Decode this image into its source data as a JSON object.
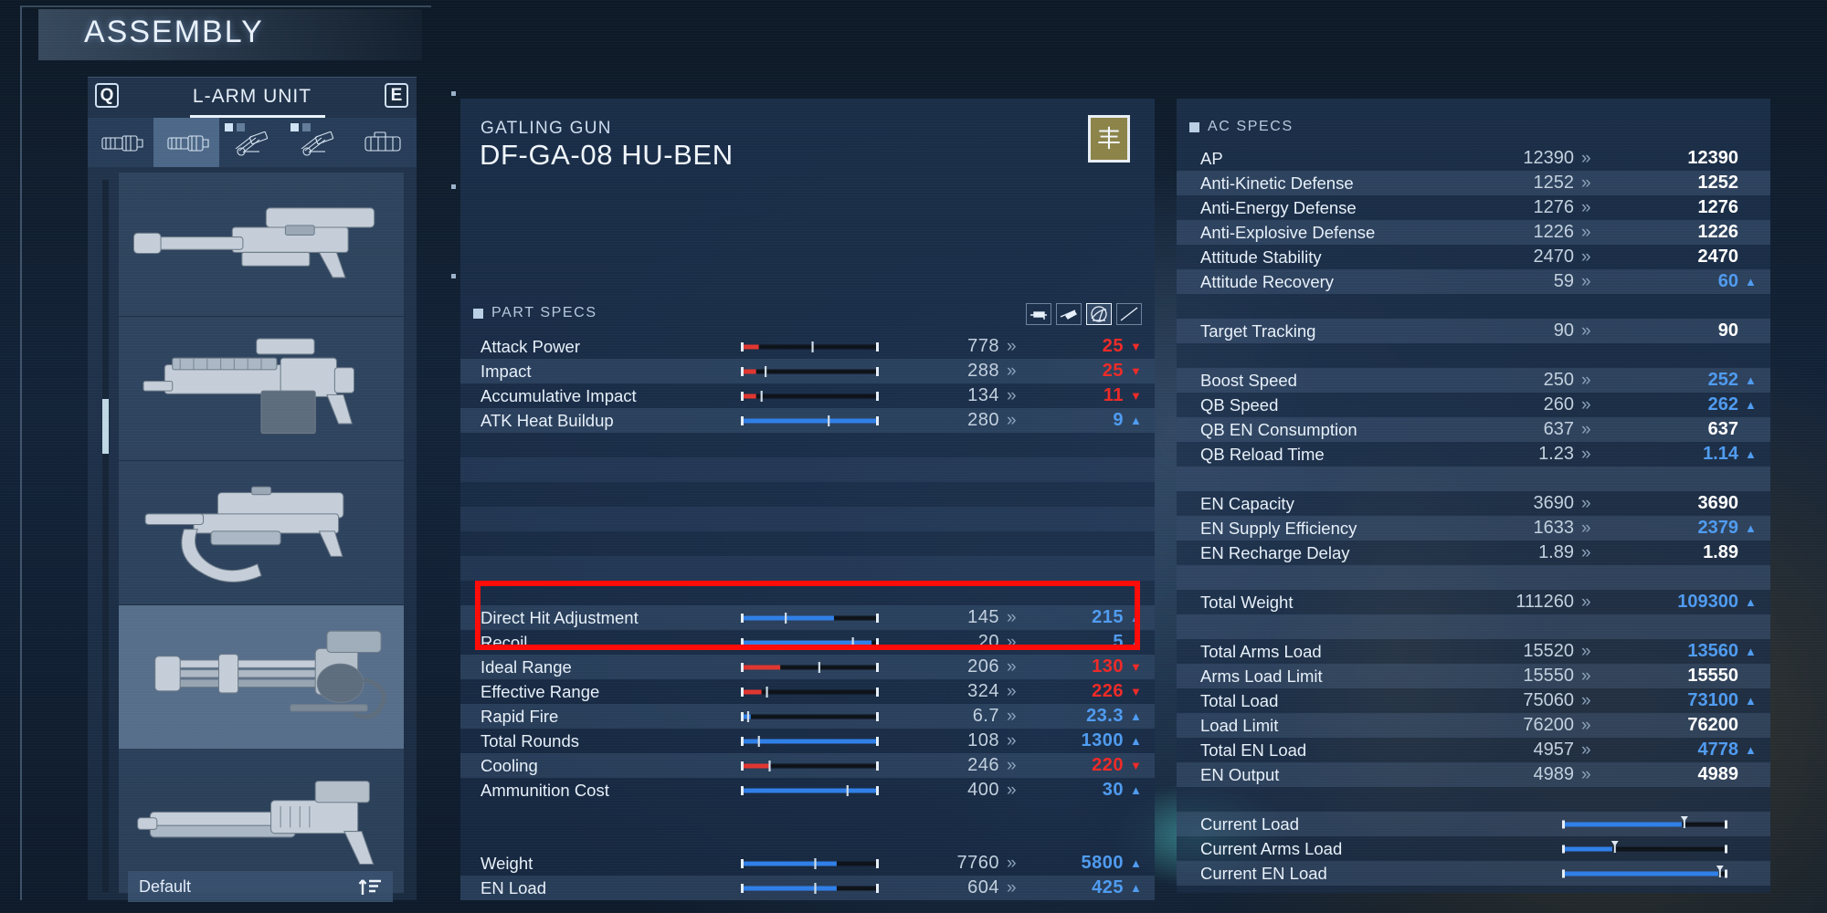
{
  "header": {
    "title": "ASSEMBLY"
  },
  "sidebar": {
    "prev_key": "Q",
    "next_key": "E",
    "category": "L-ARM UNIT",
    "tabs": [
      {
        "name": "tab-arm-unit-1",
        "icon": "arm-unit-icon",
        "selected": false,
        "dots": 0
      },
      {
        "name": "tab-arm-unit-2",
        "icon": "arm-unit-icon",
        "selected": true,
        "dots": 0
      },
      {
        "name": "tab-missile-1",
        "icon": "missile-launcher-icon",
        "selected": false,
        "dots": 2
      },
      {
        "name": "tab-missile-2",
        "icon": "missile-launcher-icon",
        "selected": false,
        "dots": 2
      },
      {
        "name": "tab-shoulder",
        "icon": "shoulder-unit-icon",
        "selected": false,
        "dots": 0
      }
    ],
    "parts": [
      {
        "name": "assault-rifle",
        "selected": false
      },
      {
        "name": "linear-rifle",
        "selected": false
      },
      {
        "name": "burst-rifle",
        "selected": false
      },
      {
        "name": "gatling-gun",
        "selected": true
      },
      {
        "name": "shotgun",
        "selected": false
      }
    ],
    "sort_label": "Default",
    "sort_icon": "sort-ascending-icon"
  },
  "part_detail": {
    "category": "GATLING GUN",
    "name": "DF-GA-08 HU-BEN",
    "manufacturer_glyph": "丰",
    "section_title": "PART SPECS",
    "mode_icons": [
      {
        "name": "weapon-view-icon",
        "active": false
      },
      {
        "name": "weapon-angle-view-icon",
        "active": false
      },
      {
        "name": "range-radar-icon",
        "active": true
      },
      {
        "name": "graph-compare-icon",
        "active": false
      }
    ],
    "stats": [
      {
        "label": "Attack Power",
        "current": "778",
        "new": "25",
        "dir": "down",
        "bar_color": "red",
        "fill": 0.12,
        "mark": 0.52
      },
      {
        "label": "Impact",
        "current": "288",
        "new": "25",
        "dir": "down",
        "bar_color": "red",
        "fill": 0.1,
        "mark": 0.17
      },
      {
        "label": "Accumulative Impact",
        "current": "134",
        "new": "11",
        "dir": "down",
        "bar_color": "red",
        "fill": 0.1,
        "mark": 0.14
      },
      {
        "label": "ATK Heat Buildup",
        "current": "280",
        "new": "9",
        "dir": "up",
        "bar_color": "blue",
        "fill": 1.0,
        "mark": 0.64
      },
      {
        "label": "",
        "current": "",
        "new": "",
        "dir": "none",
        "bar_color": "none",
        "fill": 0,
        "mark": 0
      },
      {
        "label": "",
        "current": "",
        "new": "",
        "dir": "none",
        "bar_color": "none",
        "fill": 0,
        "mark": 0
      },
      {
        "label": "",
        "current": "",
        "new": "",
        "dir": "none",
        "bar_color": "none",
        "fill": 0,
        "mark": 0
      },
      {
        "label": "",
        "current": "",
        "new": "",
        "dir": "none",
        "bar_color": "none",
        "fill": 0,
        "mark": 0
      },
      {
        "label": "",
        "current": "",
        "new": "",
        "dir": "none",
        "bar_color": "none",
        "fill": 0,
        "mark": 0
      },
      {
        "label": "",
        "current": "",
        "new": "",
        "dir": "none",
        "bar_color": "none",
        "fill": 0,
        "mark": 0
      },
      {
        "label": "",
        "current": "",
        "new": "",
        "dir": "none",
        "bar_color": "none",
        "fill": 0,
        "mark": 0
      },
      {
        "label": "Direct Hit Adjustment",
        "current": "145",
        "new": "215",
        "dir": "up",
        "bar_color": "blue",
        "fill": 0.68,
        "mark": 0.32
      },
      {
        "label": "Recoil",
        "current": "20",
        "new": "5",
        "dir": "up",
        "bar_color": "blue",
        "fill": 0.96,
        "mark": 0.82
      },
      {
        "label": "Ideal Range",
        "current": "206",
        "new": "130",
        "dir": "down",
        "bar_color": "red",
        "fill": 0.28,
        "mark": 0.57
      },
      {
        "label": "Effective Range",
        "current": "324",
        "new": "226",
        "dir": "down",
        "bar_color": "red",
        "fill": 0.14,
        "mark": 0.18
      },
      {
        "label": "Rapid Fire",
        "current": "6.7",
        "new": "23.3",
        "dir": "up",
        "bar_color": "blue",
        "fill": 0.06,
        "mark": 0.04
      },
      {
        "label": "Total Rounds",
        "current": "108",
        "new": "1300",
        "dir": "up",
        "bar_color": "blue",
        "fill": 1.0,
        "mark": 0.12
      },
      {
        "label": "Cooling",
        "current": "246",
        "new": "220",
        "dir": "down",
        "bar_color": "red",
        "fill": 0.2,
        "mark": 0.2
      },
      {
        "label": "Ammunition Cost",
        "current": "400",
        "new": "30",
        "dir": "up",
        "bar_color": "blue",
        "fill": 1.0,
        "mark": 0.78
      }
    ],
    "bottom_stats": [
      {
        "label": "Weight",
        "current": "7760",
        "new": "5800",
        "dir": "up",
        "bar_color": "blue",
        "fill": 0.7,
        "mark": 0.54
      },
      {
        "label": "EN Load",
        "current": "604",
        "new": "425",
        "dir": "up",
        "bar_color": "blue",
        "fill": 0.7,
        "mark": 0.54
      }
    ]
  },
  "ac_specs": {
    "section_title": "AC SPECS",
    "rows": [
      {
        "label": "AP",
        "current": "12390",
        "new": "12390",
        "dir": "same"
      },
      {
        "label": "Anti-Kinetic Defense",
        "current": "1252",
        "new": "1252",
        "dir": "same"
      },
      {
        "label": "Anti-Energy Defense",
        "current": "1276",
        "new": "1276",
        "dir": "same"
      },
      {
        "label": "Anti-Explosive Defense",
        "current": "1226",
        "new": "1226",
        "dir": "same"
      },
      {
        "label": "Attitude Stability",
        "current": "2470",
        "new": "2470",
        "dir": "same"
      },
      {
        "label": "Attitude Recovery",
        "current": "59",
        "new": "60",
        "dir": "up"
      },
      {
        "label": "",
        "current": "",
        "new": "",
        "dir": "none"
      },
      {
        "label": "Target Tracking",
        "current": "90",
        "new": "90",
        "dir": "same"
      },
      {
        "label": "",
        "current": "",
        "new": "",
        "dir": "none"
      },
      {
        "label": "Boost Speed",
        "current": "250",
        "new": "252",
        "dir": "up"
      },
      {
        "label": "QB Speed",
        "current": "260",
        "new": "262",
        "dir": "up"
      },
      {
        "label": "QB EN Consumption",
        "current": "637",
        "new": "637",
        "dir": "same"
      },
      {
        "label": "QB Reload Time",
        "current": "1.23",
        "new": "1.14",
        "dir": "up"
      },
      {
        "label": "",
        "current": "",
        "new": "",
        "dir": "none"
      },
      {
        "label": "EN Capacity",
        "current": "3690",
        "new": "3690",
        "dir": "same"
      },
      {
        "label": "EN Supply Efficiency",
        "current": "1633",
        "new": "2379",
        "dir": "up"
      },
      {
        "label": "EN Recharge Delay",
        "current": "1.89",
        "new": "1.89",
        "dir": "same"
      },
      {
        "label": "",
        "current": "",
        "new": "",
        "dir": "none"
      },
      {
        "label": "Total Weight",
        "current": "111260",
        "new": "109300",
        "dir": "up"
      },
      {
        "label": "",
        "current": "",
        "new": "",
        "dir": "none"
      },
      {
        "label": "Total Arms Load",
        "current": "15520",
        "new": "13560",
        "dir": "up"
      },
      {
        "label": "Arms Load Limit",
        "current": "15550",
        "new": "15550",
        "dir": "same"
      },
      {
        "label": "Total Load",
        "current": "75060",
        "new": "73100",
        "dir": "up"
      },
      {
        "label": "Load Limit",
        "current": "76200",
        "new": "76200",
        "dir": "same"
      },
      {
        "label": "Total EN Load",
        "current": "4957",
        "new": "4778",
        "dir": "up"
      },
      {
        "label": "EN Output",
        "current": "4989",
        "new": "4989",
        "dir": "same"
      },
      {
        "label": "",
        "current": "",
        "new": "",
        "dir": "none"
      }
    ],
    "gauges": [
      {
        "label": "Current Load",
        "fill": 0.73,
        "marker": 0.745
      },
      {
        "label": "Current Arms Load",
        "fill": 0.3,
        "marker": 0.315
      },
      {
        "label": "Current EN Load",
        "fill": 0.955,
        "marker": 0.965
      }
    ]
  },
  "annotation": {
    "name": "red-highlight-box",
    "color": "#fd0b08"
  },
  "colors": {
    "increase": "#4f9bf0",
    "decrease": "#ee2a27",
    "neutral": "#ffffff",
    "bar_blue": "#2f7fe8",
    "bar_red": "#e0352f"
  }
}
